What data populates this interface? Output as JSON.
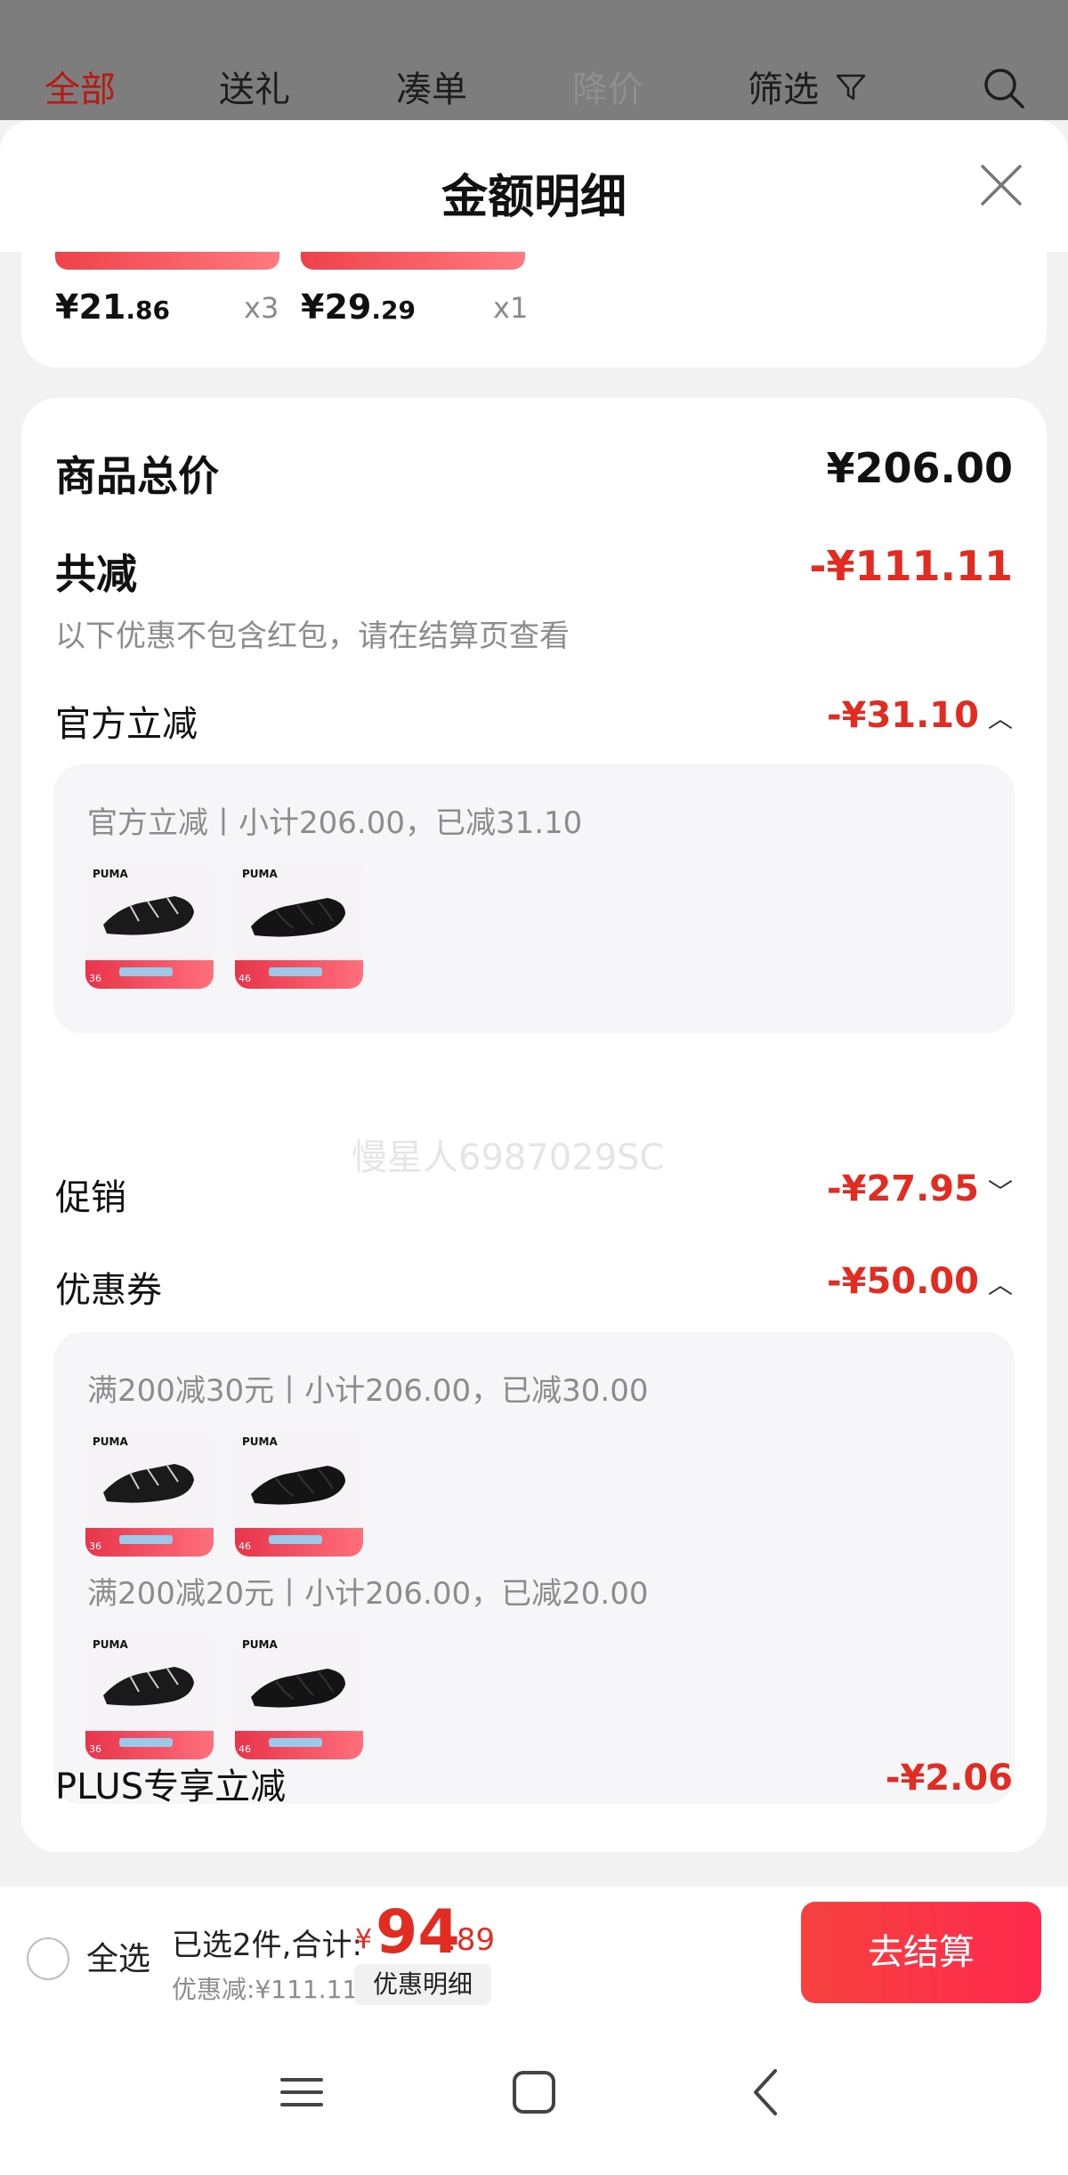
{
  "tabs": [
    {
      "label": "全部"
    },
    {
      "label": "送礼"
    },
    {
      "label": "凑单"
    },
    {
      "label": "降价"
    },
    {
      "label": "筛选"
    }
  ],
  "sheet": {
    "title": "金额明细"
  },
  "strip": {
    "items": [
      {
        "price_int": "¥21",
        "price_dec": ".86",
        "qty": "x3"
      },
      {
        "price_int": "¥29",
        "price_dec": ".29",
        "qty": "x1"
      }
    ]
  },
  "summary": {
    "goods_total_label": "商品总价",
    "goods_total_value": "¥206.00",
    "reduced_label": "共减",
    "reduced_value": "-¥111.11",
    "reduced_note": "以下优惠不包含红包，请在结算页查看"
  },
  "official": {
    "label": "官方立减",
    "value": "-¥31.10",
    "panel_line": "官方立减丨小计206.00，已减31.10"
  },
  "promo": {
    "label": "促销",
    "value": "-¥27.95"
  },
  "coupon": {
    "label": "优惠券",
    "value": "-¥50.00",
    "line1": "满200减30元丨小计206.00，已减30.00",
    "line2": "满200减20元丨小计206.00，已减20.00"
  },
  "plus": {
    "label": "PLUS专享立减",
    "value": "-¥2.06"
  },
  "thumbs": {
    "brand": "PUMA",
    "tag_a": "36",
    "tag_b": "46"
  },
  "watermark": "慢星人6987029SC",
  "footer": {
    "select_all": "全选",
    "selected_summary": "已选2件,合计:",
    "currency": "¥",
    "total_int": "94",
    "total_dec": ".89",
    "discount_note": "优惠减:¥111.11",
    "detail_chip": "优惠明细",
    "checkout": "去结算"
  },
  "colors": {
    "accent": "#e22c22",
    "checkout": "#ff2a4d"
  },
  "icons": [
    "filter-icon",
    "search-icon",
    "close-icon",
    "chevron-up-icon",
    "chevron-down-icon",
    "menu-icon",
    "home-icon",
    "back-icon"
  ]
}
